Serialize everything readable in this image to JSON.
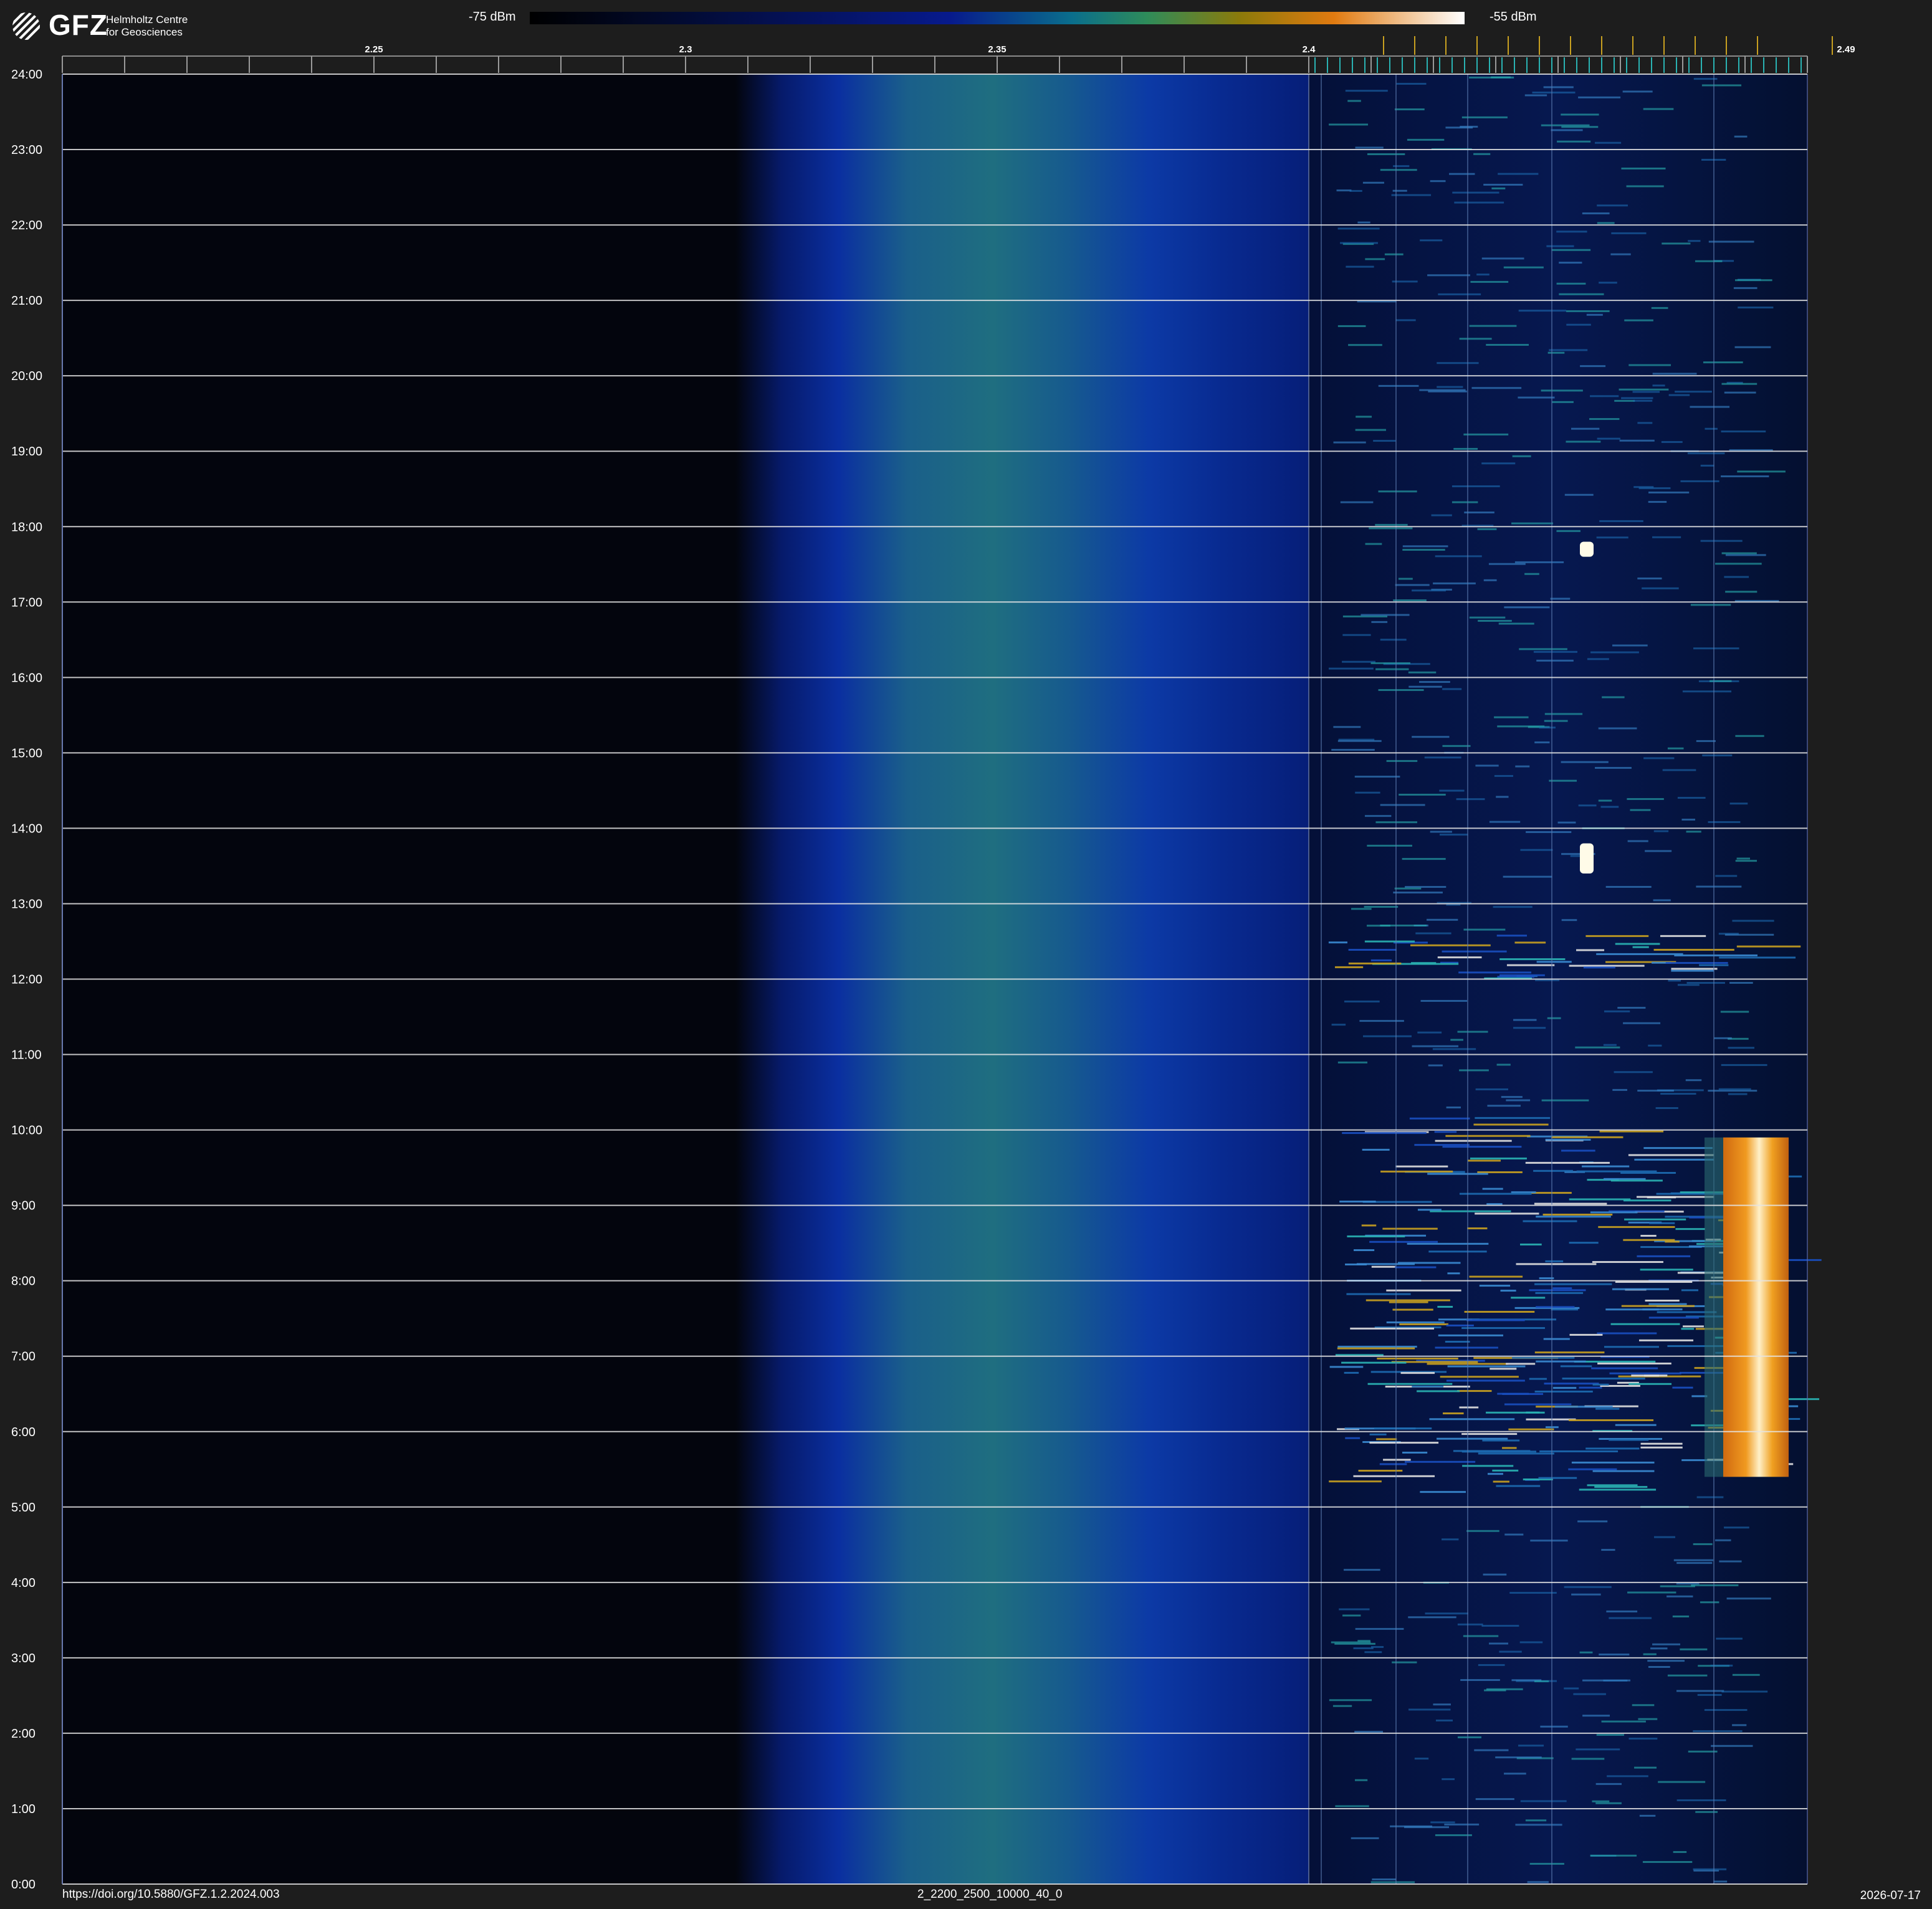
{
  "header": {
    "logo_text": "GFZ",
    "logo_sub_line1": "Helmholtz Centre",
    "logo_sub_line2": "for Geosciences"
  },
  "colorbar": {
    "min_label": "-75 dBm",
    "max_label": "-55 dBm"
  },
  "footer": {
    "doi": "https://doi.org/10.5880/GFZ.1.2.2024.003",
    "file_id": "2_2200_2500_10000_40_0",
    "date": "2026-07-17"
  },
  "colors": {
    "background": "#1d1d1d",
    "plot_background": "#03050d",
    "gridline": "#e6e6e6",
    "teal_marker": "#2ab3b3",
    "yellow_marker": "#c8a020",
    "band_blue": "#0a2a9a",
    "band_green": "#1a6a7a",
    "hot_orange": "#f08a10"
  },
  "chart_data": {
    "type": "heatmap",
    "title": "",
    "xlabel": "",
    "ylabel": "",
    "x_range_ghz": [
      2.2,
      2.48
    ],
    "y_range_hours": [
      0,
      24
    ],
    "x_tick_labels": [
      {
        "value": 2.25,
        "label": "2.25"
      },
      {
        "value": 2.3,
        "label": "2.3"
      },
      {
        "value": 2.35,
        "label": "2.35"
      },
      {
        "value": 2.4,
        "label": "2.4"
      },
      {
        "value": 2.49,
        "label": "2.49"
      }
    ],
    "x_minor_tick_step_ghz": 0.01,
    "y_tick_labels": [
      "0:00",
      "1:00",
      "2:00",
      "3:00",
      "4:00",
      "5:00",
      "6:00",
      "7:00",
      "8:00",
      "9:00",
      "10:00",
      "11:00",
      "12:00",
      "13:00",
      "14:00",
      "15:00",
      "16:00",
      "17:00",
      "18:00",
      "19:00",
      "20:00",
      "21:00",
      "22:00",
      "23:00",
      "24:00"
    ],
    "colorscale_dbm": [
      -75,
      -55
    ],
    "broadband_band_ghz": [
      2.308,
      2.4,
      2.324,
      2.388
    ],
    "ism_band_ghz": [
      2.4,
      2.48
    ],
    "intense_block": {
      "freq_ghz": [
        2.4665,
        2.477
      ],
      "time_hours": [
        5.4,
        9.9
      ]
    },
    "busy_periods_hours": [
      [
        5.2,
        10.2
      ],
      [
        12.0,
        12.6
      ]
    ],
    "bright_bursts": [
      {
        "freq_ghz": 2.4445,
        "time_hours": [
          13.4,
          13.8
        ]
      },
      {
        "freq_ghz": 2.4445,
        "time_hours": [
          17.6,
          17.8
        ]
      }
    ]
  }
}
